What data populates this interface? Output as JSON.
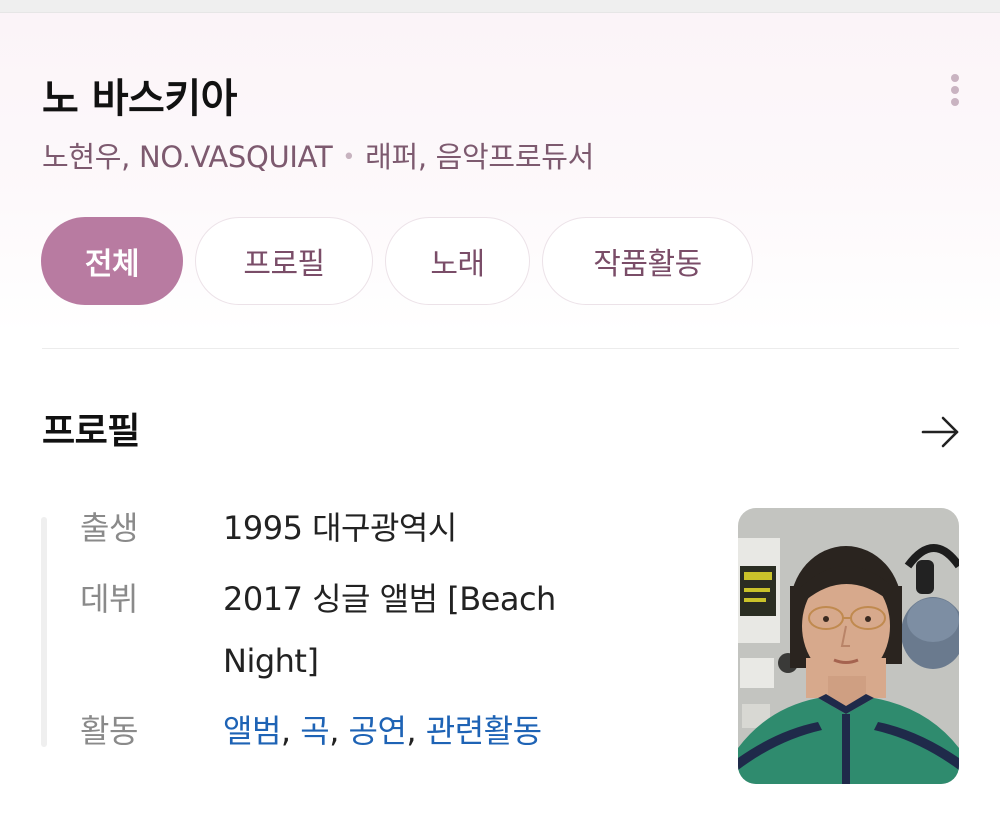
{
  "artist": {
    "name": "노 바스키아",
    "aliases": "노현우, NO.VASQUIAT",
    "occupation": "래퍼, 음악프로듀서"
  },
  "tabs": [
    {
      "label": "전체",
      "active": true
    },
    {
      "label": "프로필",
      "active": false
    },
    {
      "label": "노래",
      "active": false
    },
    {
      "label": "작품활동",
      "active": false
    }
  ],
  "profile": {
    "section_title": "프로필",
    "birth_label": "출생",
    "birth_value": "1995 대구광역시",
    "debut_label": "데뷔",
    "debut_value": "2017 싱글 앨범 [Beach Night]",
    "activity_label": "활동",
    "activity_links": [
      "앨범",
      "곡",
      "공연",
      "관련활동"
    ],
    "link_separator": ", "
  },
  "icons": {
    "more": "more-vertical-icon",
    "arrow": "arrow-right-icon"
  },
  "colors": {
    "accent": "#b87ba1",
    "subtitle": "#7d5a6f",
    "link": "#1e63b5"
  }
}
